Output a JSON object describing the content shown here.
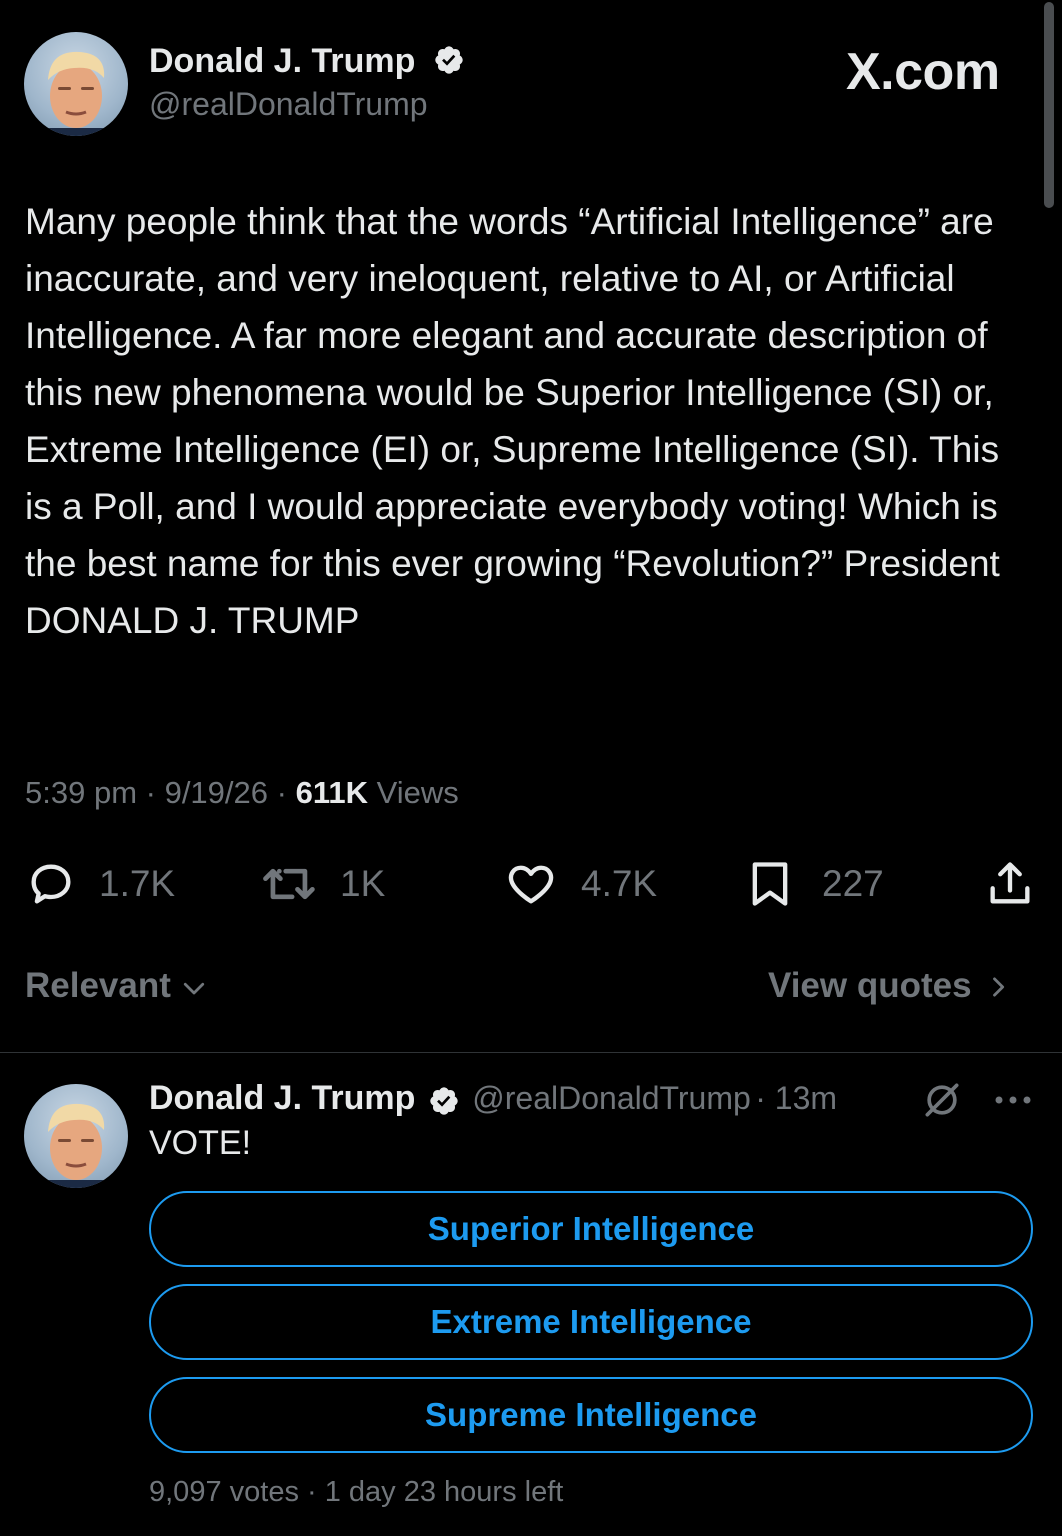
{
  "watermark": "X.com",
  "main_post": {
    "author": {
      "name": "Donald J. Trump",
      "handle": "@realDonaldTrump"
    },
    "text": "Many people think that the words “Artificial Intelligence” are inaccurate, and very ineloquent, relative to AI, or Artificial Intelligence. A far more elegant and accurate description of this new phenomena would be Superior Intelligence (SI) or, Extreme Intelligence (EI) or, Supreme Intelligence (SI). This is a Poll, and I would appreciate everybody voting! Which is the best name for this ever growing “Revolution?” President DONALD J. TRUMP",
    "time": "5:39 pm",
    "date": "9/19/26",
    "views_count": "611K",
    "views_label": "Views",
    "metrics": {
      "replies": "1.7K",
      "reposts": "1K",
      "likes": "4.7K",
      "bookmarks": "227"
    }
  },
  "sort": {
    "relevant_label": "Relevant",
    "view_quotes_label": "View quotes"
  },
  "reply": {
    "author": {
      "name": "Donald J. Trump",
      "handle": "@realDonaldTrump",
      "time": "13m"
    },
    "text": "VOTE!",
    "poll": {
      "options": [
        "Superior Intelligence",
        "Extreme Intelligence",
        "Supreme Intelligence"
      ],
      "votes": "9,097 votes",
      "time_left": "1 day 23 hours left"
    }
  },
  "colors": {
    "background": "#000000",
    "text": "#e7e9ea",
    "secondary": "#71767b",
    "accent": "#1d9bf0",
    "verified": "#1d9bf0",
    "divider": "#2f3336"
  },
  "icons": [
    "verified-badge-icon",
    "reply-icon",
    "repost-icon",
    "like-icon",
    "bookmark-icon",
    "share-icon",
    "chevron-down-icon",
    "chevron-right-icon",
    "grok-icon",
    "more-icon"
  ]
}
